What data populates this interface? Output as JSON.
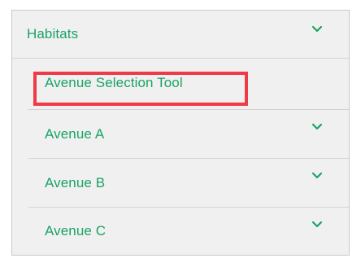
{
  "menu": {
    "items": [
      {
        "label": "Habitats",
        "icon": "chevron-down-icon"
      },
      {
        "label": "Avenue Selection Tool"
      },
      {
        "label": "Avenue A",
        "icon": "chevron-down-icon"
      },
      {
        "label": "Avenue B",
        "icon": "chevron-down-icon"
      },
      {
        "label": "Avenue C",
        "icon": "chevron-down-icon"
      }
    ]
  },
  "colors": {
    "accent": "#1aa364",
    "highlight": "#ef3a47",
    "background": "#f0f0f0"
  }
}
